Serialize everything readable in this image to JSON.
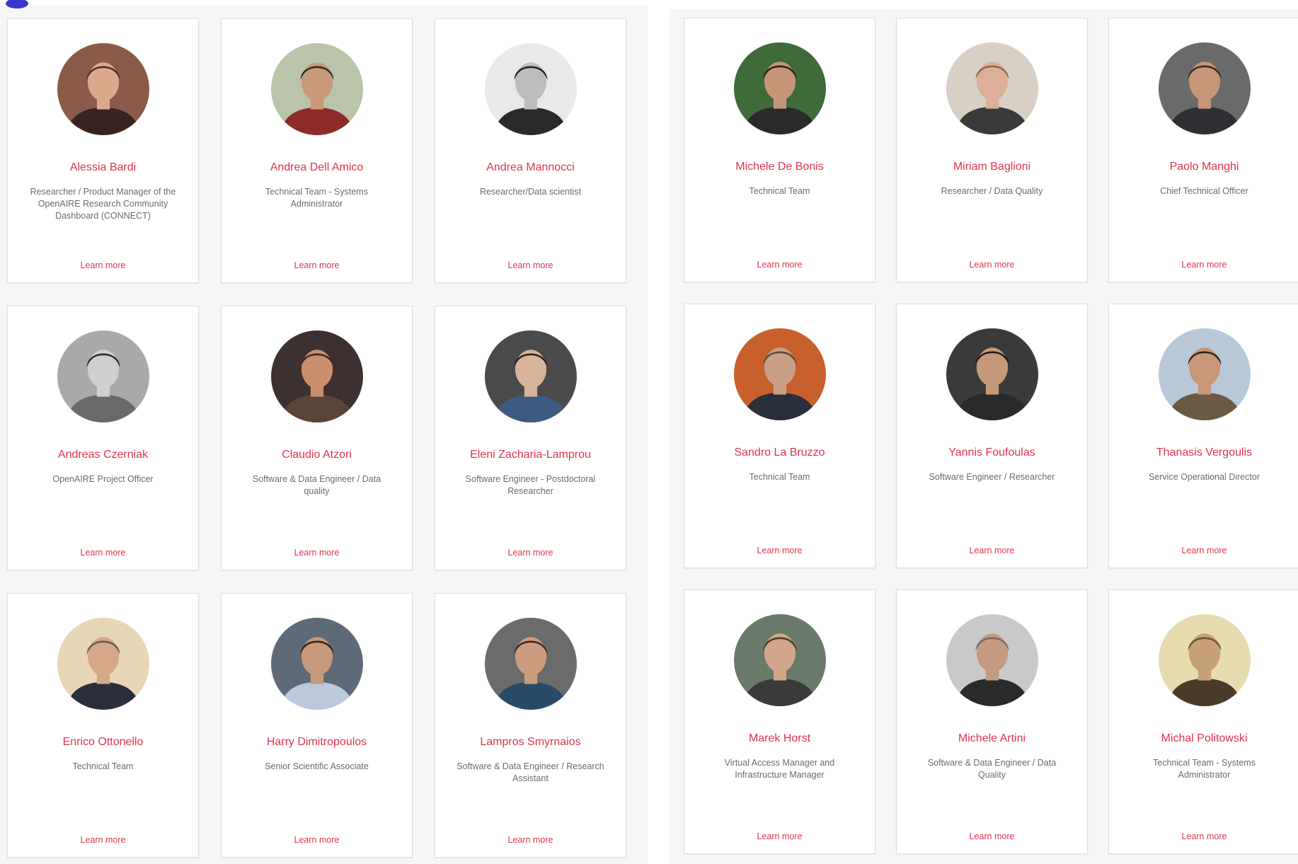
{
  "left_panel": {
    "cards": [
      {
        "name": "Alessia Bardi",
        "role": "Researcher / Product Manager of the OpenAIRE Research Community Dashboard (CONNECT)",
        "link": "Learn more",
        "photo_bg": "#8a5a4a",
        "skin": "#d9a98a",
        "hair": "#4a2d20",
        "shirt": "#3a2220"
      },
      {
        "name": "Andrea Dell Amico",
        "role": "Technical Team - Systems Administrator",
        "link": "Learn more",
        "photo_bg": "#b9c4a8",
        "skin": "#c89a78",
        "hair": "#2e2a26",
        "shirt": "#8e2a2a"
      },
      {
        "name": "Andrea Mannocci",
        "role": "Researcher/Data scientist",
        "link": "Learn more",
        "photo_bg": "#e9e9e9",
        "skin": "#bdbdbd",
        "hair": "#1f1f1f",
        "shirt": "#2a2a2a"
      },
      {
        "name": "Andreas Czerniak",
        "role": "OpenAIRE Project Officer",
        "link": "Learn more",
        "photo_bg": "#a9a9a9",
        "skin": "#cfcfcf",
        "hair": "#2b2b2b",
        "shirt": "#6a6a6a"
      },
      {
        "name": "Claudio Atzori",
        "role": "Software & Data Engineer / Data quality",
        "link": "Learn more",
        "photo_bg": "#3c3030",
        "skin": "#c98f6c",
        "hair": "#3a2a22",
        "shirt": "#5a4438"
      },
      {
        "name": "Eleni Zacharia-Lamprou",
        "role": "Software Engineer - Postdoctoral Researcher",
        "link": "Learn more",
        "photo_bg": "#4a4a4a",
        "skin": "#d7b39a",
        "hair": "#2a1f1a",
        "shirt": "#3f5a80"
      },
      {
        "name": "Enrico Ottonello",
        "role": "Technical Team",
        "link": "Learn more",
        "photo_bg": "#e8d7b6",
        "skin": "#d6a888",
        "hair": "#6b5a4a",
        "shirt": "#2b2f3a"
      },
      {
        "name": "Harry Dimitropoulos",
        "role": "Senior Scientific Associate",
        "link": "Learn more",
        "photo_bg": "#5f6a78",
        "skin": "#c8987a",
        "hair": "#2c2420",
        "shirt": "#bcc8dc"
      },
      {
        "name": "Lampros Smyrnaios",
        "role": "Software & Data Engineer / Research Assistant",
        "link": "Learn more",
        "photo_bg": "#6b6b6b",
        "skin": "#cc9c7e",
        "hair": "#3a2a20",
        "shirt": "#2a4a6a"
      }
    ]
  },
  "right_panel": {
    "cards": [
      {
        "name": "Michele De Bonis",
        "role": "Technical Team",
        "link": "Learn more",
        "photo_bg": "#3f6a3a",
        "skin": "#c49676",
        "hair": "#2a1e18",
        "shirt": "#2a2a2a"
      },
      {
        "name": "Miriam Baglioni",
        "role": "Researcher / Data Quality",
        "link": "Learn more",
        "photo_bg": "#d8d0c4",
        "skin": "#dcb098",
        "hair": "#8a6a44",
        "shirt": "#3a3a3a"
      },
      {
        "name": "Paolo Manghi",
        "role": "Chief Technical Officer",
        "link": "Learn more",
        "photo_bg": "#6a6a6a",
        "skin": "#c79676",
        "hair": "#3a2a20",
        "shirt": "#2f2f33"
      },
      {
        "name": "Sandro La Bruzzo",
        "role": "Technical Team",
        "link": "Learn more",
        "photo_bg": "#c8602e",
        "skin": "#c9a086",
        "hair": "#5a4a40",
        "shirt": "#2a2f3c"
      },
      {
        "name": "Yannis Foufoulas",
        "role": "Software Engineer / Researcher",
        "link": "Learn more",
        "photo_bg": "#3a3a3a",
        "skin": "#c6987a",
        "hair": "#1f1a18",
        "shirt": "#2a2a2a"
      },
      {
        "name": "Thanasis Vergoulis",
        "role": "Service Operational Director",
        "link": "Learn more",
        "photo_bg": "#b8c8d8",
        "skin": "#c89878",
        "hair": "#2e241e",
        "shirt": "#6a5a44"
      },
      {
        "name": "Marek Horst",
        "role": "Virtual Access Manager and Infrastructure Manager",
        "link": "Learn more",
        "photo_bg": "#6a7a6a",
        "skin": "#d2a68a",
        "hair": "#4a3a2a",
        "shirt": "#3a3a3a"
      },
      {
        "name": "Michele Artini",
        "role": "Software & Data Engineer / Data Quality",
        "link": "Learn more",
        "photo_bg": "#c9c9c9",
        "skin": "#c49a80",
        "hair": "#7a6a60",
        "shirt": "#2a2a2a"
      },
      {
        "name": "Michal Politowski",
        "role": "Technical Team - Systems Administrator",
        "link": "Learn more",
        "photo_bg": "#e6dcb0",
        "skin": "#c8a078",
        "hair": "#6a5236",
        "shirt": "#4a3a2a"
      }
    ]
  }
}
